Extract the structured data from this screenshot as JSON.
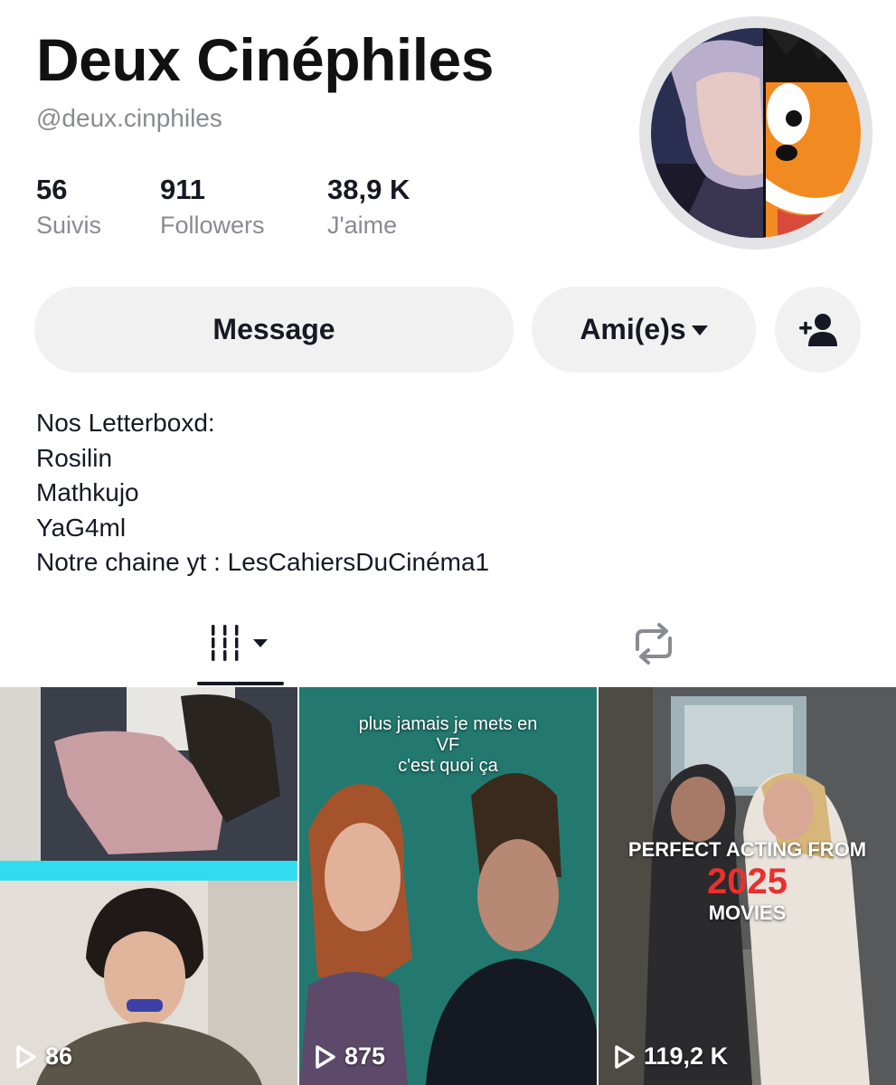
{
  "profile": {
    "name": "Deux Cinéphiles",
    "handle": "@deux.cinphiles"
  },
  "stats": [
    {
      "value": "56",
      "label": "Suivis"
    },
    {
      "value": "911",
      "label": "Followers"
    },
    {
      "value": "38,9 K",
      "label": "J'aime"
    }
  ],
  "actions": {
    "message_label": "Message",
    "friends_label": "Ami(e)s",
    "add_friend_icon": "add-user-icon"
  },
  "bio": [
    "Nos Letterboxd:",
    "Rosilin",
    "Mathkujo",
    "YaG4ml",
    "Notre chaine yt : LesCahiersDuCinéma1"
  ],
  "tabs": {
    "videos_icon": "grid-lines-icon",
    "reposts_icon": "repost-icon"
  },
  "videos": [
    {
      "views": "86",
      "overlay_lines": []
    },
    {
      "views": "875",
      "overlay_lines": [
        "plus jamais je mets en",
        "VF",
        "c'est quoi ça"
      ]
    },
    {
      "views": "119,2 K",
      "overlay_lines": [
        "PERFECT ACTING FROM",
        "2025",
        "MOVIES"
      ]
    }
  ],
  "colors": {
    "text": "#161823",
    "secondary_text": "#8a8b91",
    "button_bg": "#f1f1f2",
    "accent_red": "#e8312f",
    "cyan_band": "#32dcf0"
  }
}
